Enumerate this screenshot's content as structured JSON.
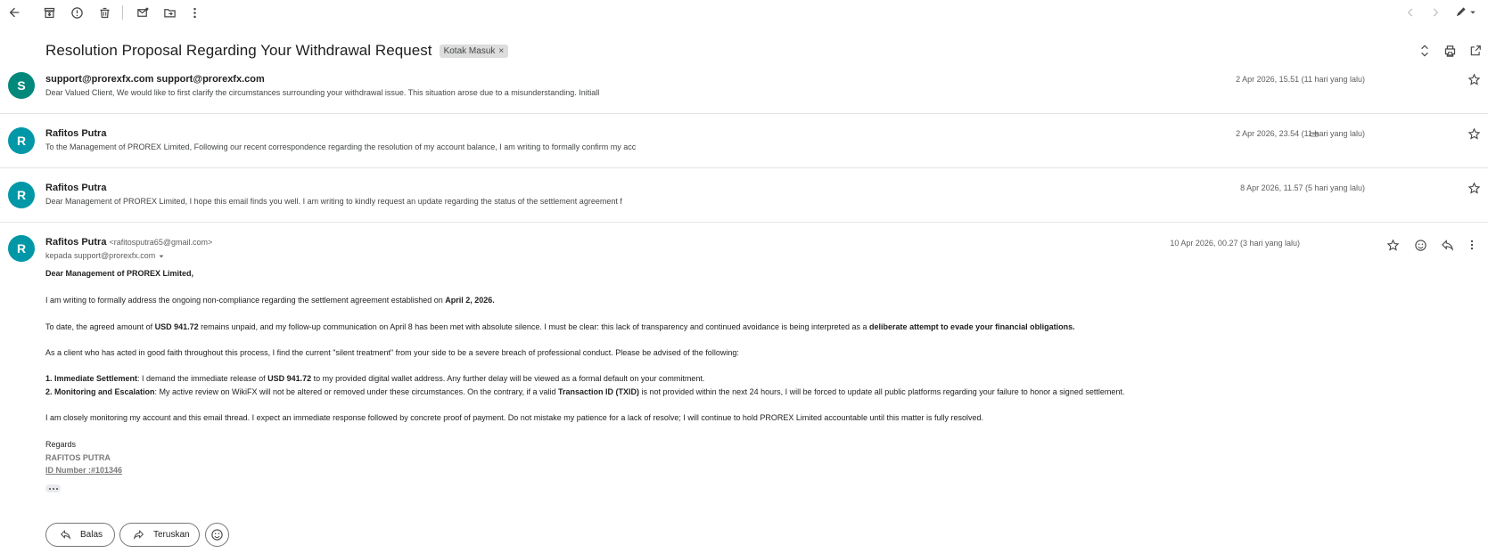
{
  "subject": {
    "title": "Resolution Proposal Regarding Your Withdrawal Request",
    "label": "Kotak Masuk",
    "label_remove": "×"
  },
  "messages": [
    {
      "avatar_letter": "S",
      "avatar_color": "#00897b",
      "sender": "support@prorexfx.com support@prorexfx.com",
      "snippet": "Dear Valued Client, We would like to first clarify the circumstances surrounding your withdrawal issue. This situation arose due to a misunderstanding. Initiall",
      "date": "2 Apr 2026, 15.51 (11 hari yang lalu)"
    },
    {
      "avatar_letter": "R",
      "avatar_color": "#0097a7",
      "sender": "Rafitos Putra",
      "snippet": "To the Management of PROREX Limited, Following our recent correspondence regarding the resolution of my account balance, I am writing to formally confirm my acc",
      "date": "2 Apr 2026, 23.54 (11 hari yang lalu)",
      "has_attachment": true
    },
    {
      "avatar_letter": "R",
      "avatar_color": "#0097a7",
      "sender": "Rafitos Putra",
      "snippet": "Dear Management of PROREX Limited, I hope this email finds you well. I am writing to kindly request an update regarding the status of the settlement agreement f",
      "date": "8 Apr 2026, 11.57 (5 hari yang lalu)"
    }
  ],
  "open_message": {
    "avatar_letter": "R",
    "avatar_color": "#0097a7",
    "sender": "Rafitos Putra",
    "sender_email": "<rafitosputra65@gmail.com>",
    "recipient": "kepada support@prorexfx.com",
    "date": "10 Apr 2026, 00.27 (3 hari yang lalu)",
    "body": {
      "greeting": "Dear Management of PROREX Limited,",
      "p1_a": "I am writing to formally address the ongoing non-compliance regarding the settlement agreement established on ",
      "p1_b": "April 2, 2026.",
      "p2_a": "To date, the agreed amount of ",
      "p2_b": "USD 941.72",
      "p2_c": " remains unpaid, and my follow-up communication on April 8 has been met with absolute silence. I must be clear: this lack of transparency and continued avoidance is being interpreted as a ",
      "p2_d": "deliberate attempt to evade your financial obligations.",
      "p3": "As a client who has acted in good faith throughout this process, I find the current \"silent treatment\" from your side to be a severe breach of professional conduct. Please be advised of the following:",
      "l1_a": "1. Immediate Settlement",
      "l1_b": ": I demand the immediate release of ",
      "l1_c": "USD 941.72",
      "l1_d": " to my provided digital wallet address. Any further delay will be viewed as a formal default on your commitment.",
      "l2_a": "2. Monitoring and Escalation",
      "l2_b": ": My active review on WikiFX will not be altered or removed under these circumstances. On the contrary, if a valid ",
      "l2_c": "Transaction ID (TXID)",
      "l2_d": " is not provided within the next 24 hours, I will be forced to update all public platforms regarding your failure to honor a signed settlement.",
      "p4": "I am closely monitoring my account and this email thread. I expect an immediate response followed by concrete proof of payment. Do not mistake my patience for a lack of resolve; I will continue to hold PROREX Limited accountable until this matter is fully resolved.",
      "regards": "Regards",
      "sig_name": "RAFITOS PUTRA",
      "sig_id": "ID Number :#101346"
    }
  },
  "actions": {
    "reply": "Balas",
    "forward": "Teruskan"
  }
}
